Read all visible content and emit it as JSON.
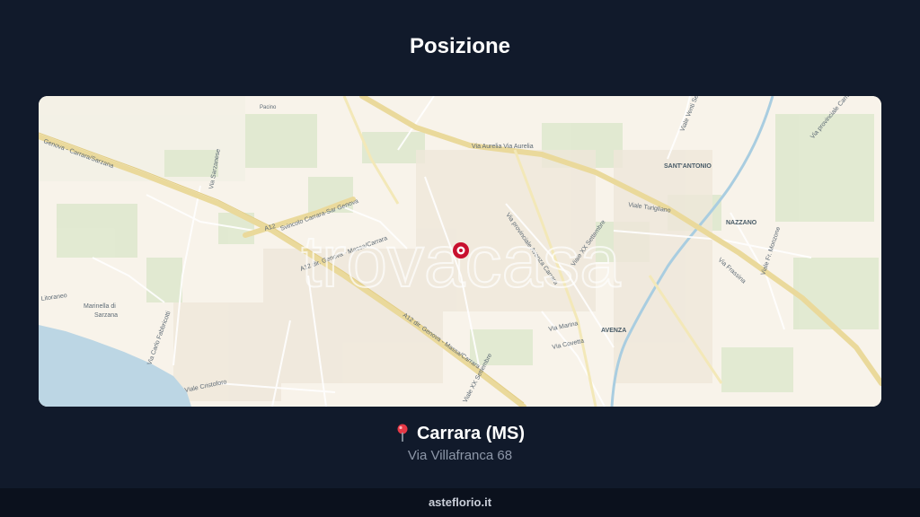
{
  "page": {
    "title": "Posizione",
    "location_name": "Carrara (MS)",
    "address": "Via Villafranca 68",
    "footer": "asteflorio.it"
  },
  "icons": {
    "location": "location-pin-icon",
    "marker": "map-marker-icon"
  },
  "colors": {
    "background": "#111a2b",
    "marker": "#c8102e",
    "map_land": "#f8f3ea",
    "map_sea": "#bcd6e4"
  },
  "map": {
    "watermark": "trovacasa",
    "labels": {
      "genova_carrara_sarzana": "Genova - Carrara/Sarzana",
      "a12": "A12",
      "svincolo": "Svincolo Carrara-Sar Genova",
      "a12_dir_genova": "A12 dir. Genova - Massa/Carrara",
      "a12_dir_genova_2": "A12 dir. Genova - Massa/Carrara",
      "via_aurelia": "Via Aurelia  Via Aurelia",
      "sant_antonio": "SANT'ANTONIO",
      "nazzano": "NAZZANO",
      "avenza": "AVENZA",
      "marinella": "Marinella di",
      "sarzana": "Sarzana",
      "litoraneo": "Litoraneo",
      "viale_turigliano": "Viale Turigliano",
      "viale_xx_settembre": "Viale XX Settembre",
      "viale_xx_settembre_2": "Viale XX Settembre",
      "via_provinciale": "Via provinciale Avenza Carrara",
      "viale_fr": "Viale Fr. Monzone",
      "via_frassina": "Via Frassina",
      "viale_cristoforo": "Viale Cristoforo",
      "via_covetta": "Via Covetta",
      "via_marina": "Via Marina",
      "via_fabbricotti": "Via Carlo Fabbricotti",
      "via_pacino": "Pacino",
      "via_sarzanese": "Via Sarzanese",
      "via_provinciale_carr": "Via provinciale Carrara",
      "viale_vs": "Viale Venti Settembre"
    }
  }
}
